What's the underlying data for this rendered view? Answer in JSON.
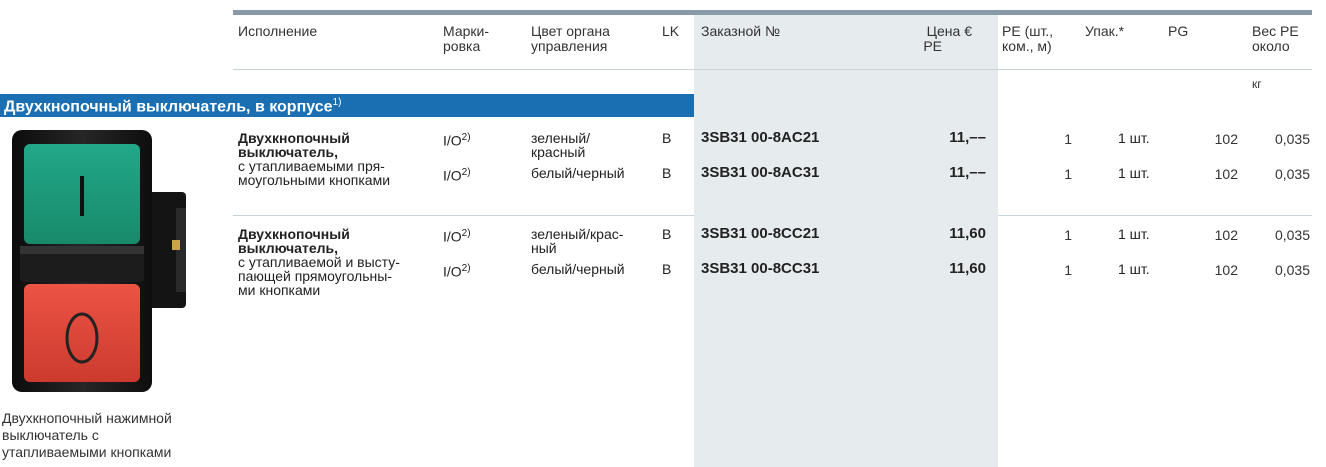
{
  "header": {
    "col_execution": "Исполнение",
    "col_marking_1": "Марки-",
    "col_marking_2": "ровка",
    "col_color_1": "Цвет органа",
    "col_color_2": "управления",
    "col_lk": "LK",
    "col_order": "Заказной №",
    "col_price_1": "Цена €",
    "col_price_2": "PE",
    "col_pe_1": "PE (шт.,",
    "col_pe_2": "ком., м)",
    "col_pack": "Упак.*",
    "col_pg": "PG",
    "col_weight_1": "Вес PE",
    "col_weight_2": "около",
    "col_weight_unit": "кг"
  },
  "section": {
    "title": "Двухкнопочный выключатель, в корпусе",
    "footnote": "1)"
  },
  "group1": {
    "desc_bold_1": "Двухкнопочный",
    "desc_bold_2": "выключатель,",
    "desc_3": "с утапливаемыми пря-",
    "desc_4": "моугольными кнопками",
    "rows": [
      {
        "marking": "I/O",
        "marking_sup": "2)",
        "color_1": "зеленый/",
        "color_2": "красный",
        "lk": "B",
        "order": "3SB31 00-8AC21",
        "price": "11,––",
        "pe": "1",
        "pack": "1 шт.",
        "pg": "102",
        "weight": "0,035"
      },
      {
        "marking": "I/O",
        "marking_sup": "2)",
        "color_1": "белый/черный",
        "color_2": "",
        "lk": "B",
        "order": "3SB31 00-8AC31",
        "price": "11,––",
        "pe": "1",
        "pack": "1 шт.",
        "pg": "102",
        "weight": "0,035"
      }
    ]
  },
  "group2": {
    "desc_bold_1": "Двухкнопочный",
    "desc_bold_2": "выключатель,",
    "desc_3": "с утапливаемой и высту-",
    "desc_4": "пающей прямоугольны-",
    "desc_5": "ми кнопками",
    "rows": [
      {
        "marking": "I/O",
        "marking_sup": "2)",
        "color_1": "зеленый/крас-",
        "color_2": "ный",
        "lk": "B",
        "order": "3SB31 00-8CC21",
        "price": "11,60",
        "pe": "1",
        "pack": "1 шт.",
        "pg": "102",
        "weight": "0,035"
      },
      {
        "marking": "I/O",
        "marking_sup": "2)",
        "color_1": "белый/черный",
        "color_2": "",
        "lk": "B",
        "order": "3SB31 00-8CC31",
        "price": "11,60",
        "pe": "1",
        "pack": "1 шт.",
        "pg": "102",
        "weight": "0,035"
      }
    ]
  },
  "image": {
    "caption_1": "Двухкнопочный нажимной",
    "caption_2": "выключатель с",
    "caption_3": "утапливаемыми кнопками",
    "top_symbol": "I",
    "bottom_symbol": "O",
    "top_color": "#1f9e7c",
    "bottom_color": "#e2473a"
  },
  "colors": {
    "section_bar": "#1a6fb2",
    "order_column_bg": "#e6ebee",
    "top_rule": "#889aa6"
  }
}
